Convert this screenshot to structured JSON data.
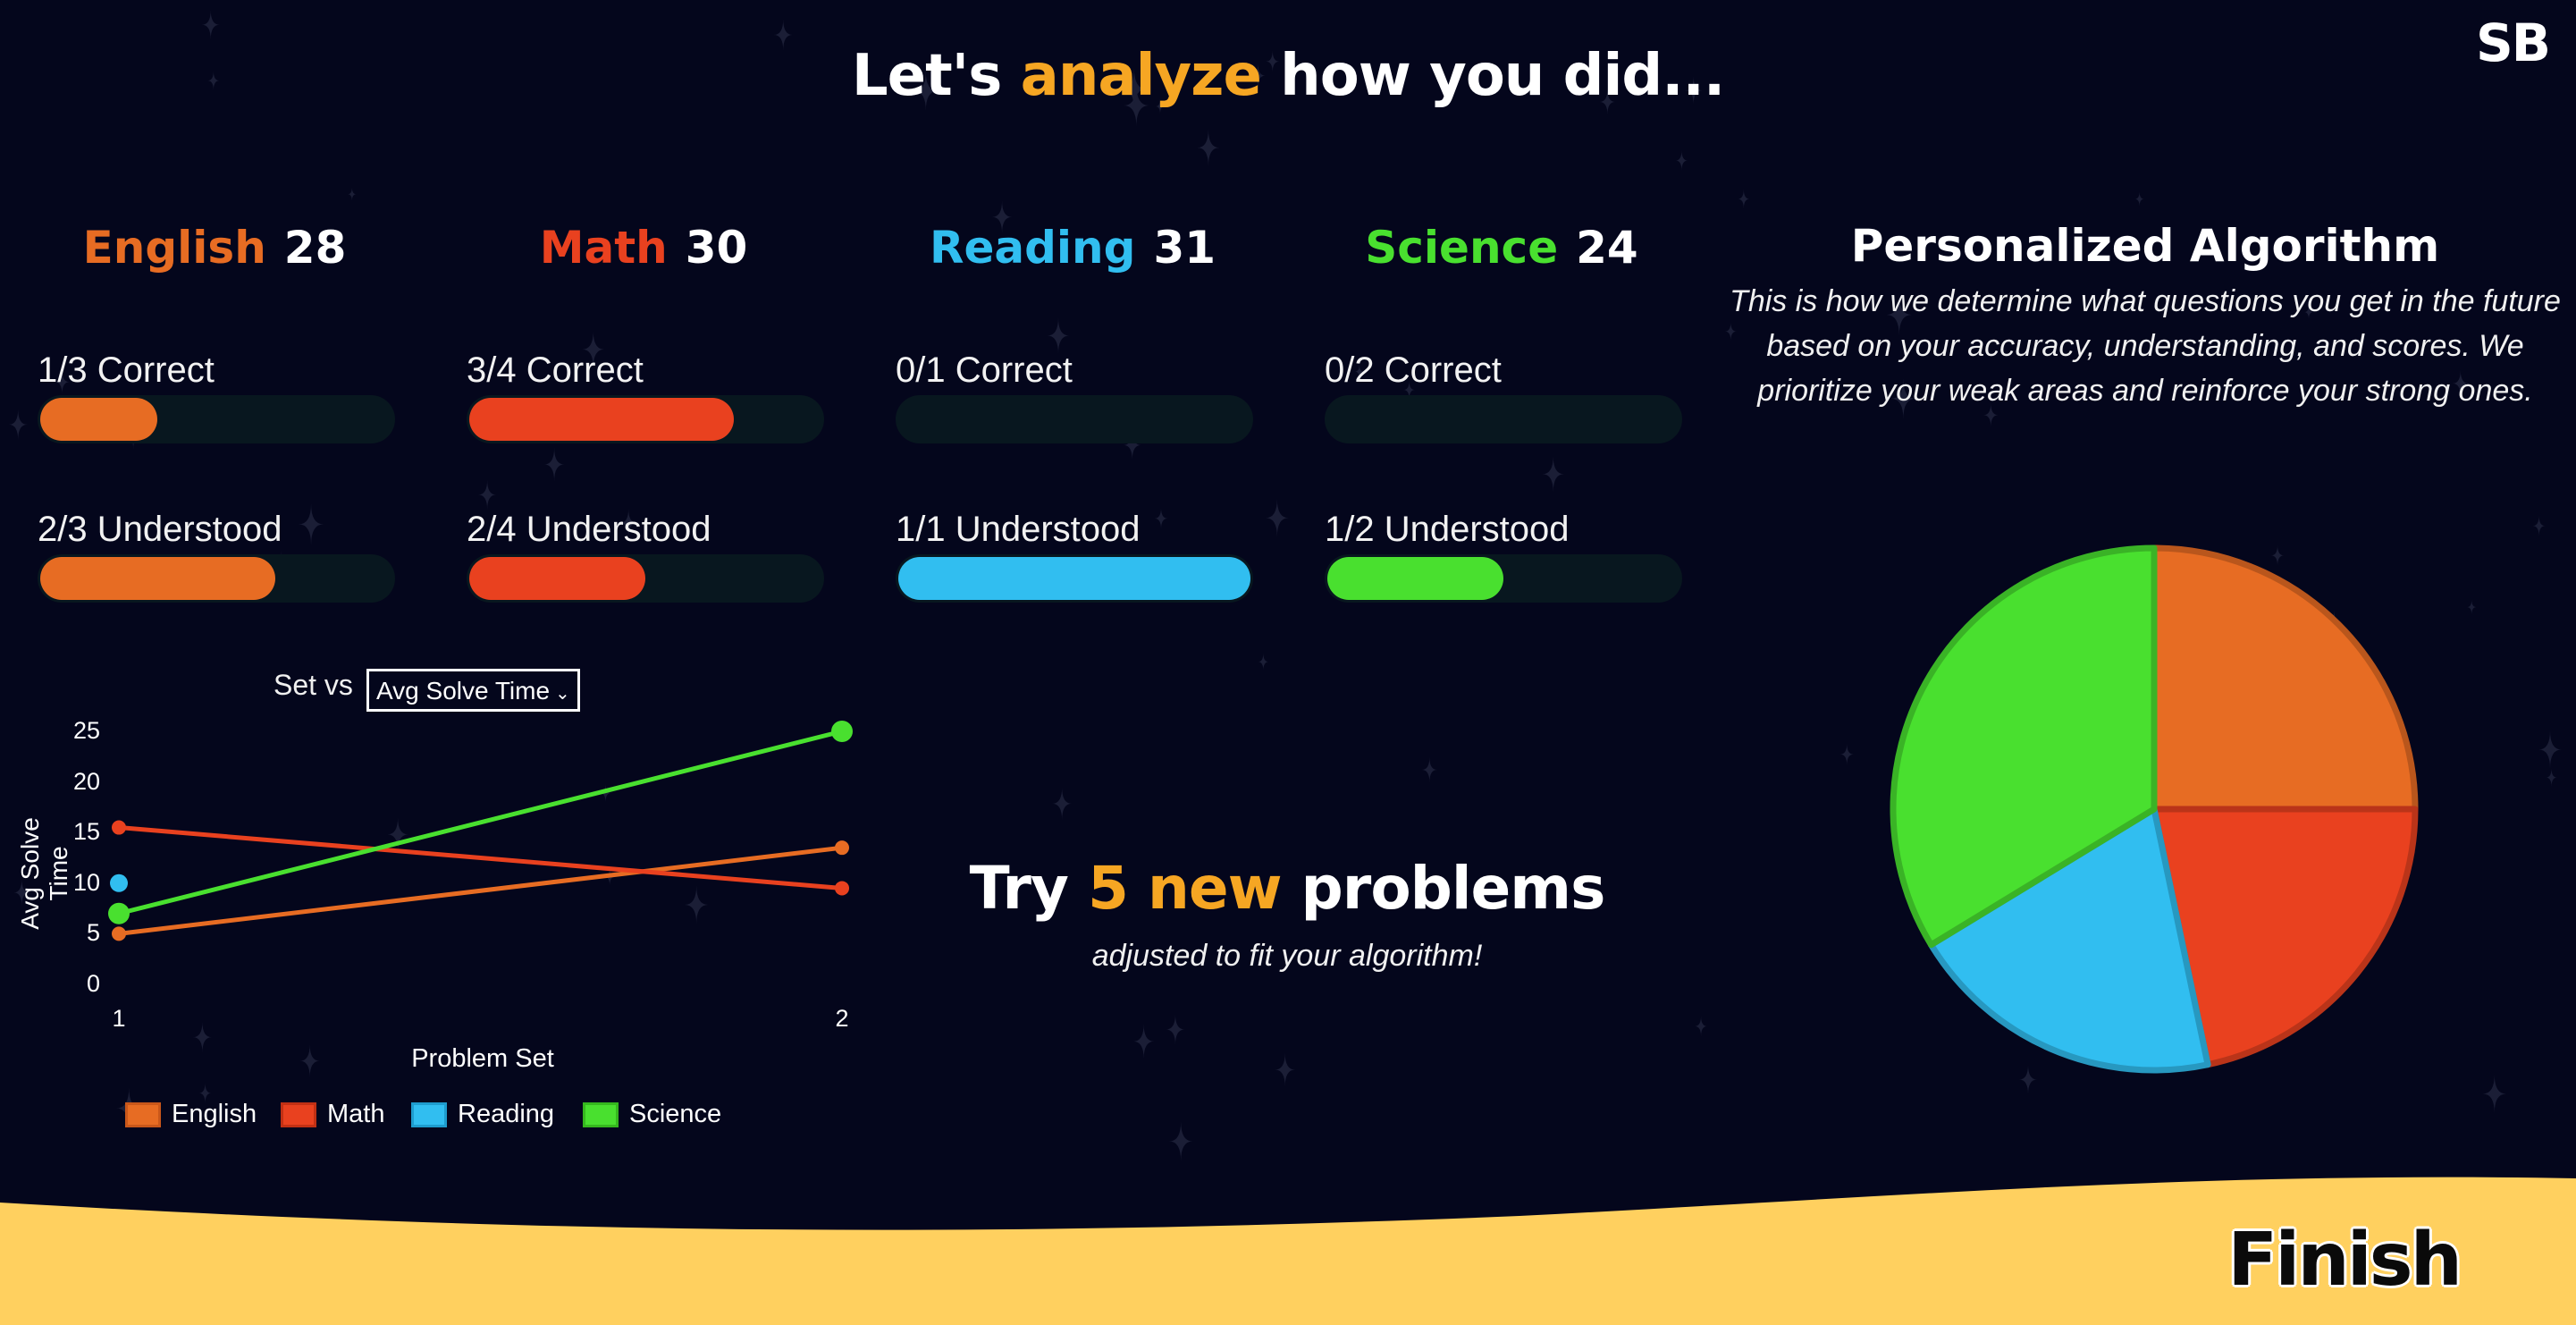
{
  "header": {
    "title_pre": "Let's ",
    "title_accent": "analyze",
    "title_post": " how you did...",
    "accent_color": "#f6a623",
    "avatar_initials": "SB"
  },
  "subjects": [
    {
      "name": "English",
      "score": "28",
      "color": "#e76c23",
      "correct_label": "1/3 Correct",
      "correct_fraction": 0.333,
      "understood_label": "2/3 Understood",
      "understood_fraction": 0.667
    },
    {
      "name": "Math",
      "score": "30",
      "color": "#e9411f",
      "correct_label": "3/4 Correct",
      "correct_fraction": 0.75,
      "understood_label": "2/4 Understood",
      "understood_fraction": 0.5
    },
    {
      "name": "Reading",
      "score": "31",
      "color": "#31bef0",
      "correct_label": "0/1 Correct",
      "correct_fraction": 0,
      "understood_label": "1/1 Understood",
      "understood_fraction": 1
    },
    {
      "name": "Science",
      "score": "24",
      "color": "#49e02f",
      "correct_label": "0/2 Correct",
      "correct_fraction": 0,
      "understood_label": "1/2 Understood",
      "understood_fraction": 0.5
    }
  ],
  "algorithm": {
    "title": "Personalized Algorithm",
    "description": "This is how we determine what questions you get in the future based on your accuracy, understanding, and scores. We prioritize your weak areas and reinforce your strong ones."
  },
  "promo": {
    "pre": "Try ",
    "accent": "5 new",
    "post": " problems",
    "subtitle": "adjusted to fit your algorithm!"
  },
  "chart_controls": {
    "set_label": "Set vs",
    "metric_value": "Avg Solve Time"
  },
  "chart_data": [
    {
      "type": "line",
      "xlabel": "Problem Set",
      "ylabel": "Avg Solve Time",
      "x": [
        1,
        2
      ],
      "x_ticks": [
        "1",
        "2"
      ],
      "y_ticks": [
        "0",
        "5",
        "10",
        "15",
        "20",
        "25"
      ],
      "ylim": [
        0,
        25
      ],
      "legend_position": "bottom",
      "series": [
        {
          "name": "English",
          "color": "#e76c23",
          "values": [
            5,
            13.5
          ]
        },
        {
          "name": "Math",
          "color": "#e9411f",
          "values": [
            15.5,
            9.5
          ]
        },
        {
          "name": "Reading",
          "color": "#31bef0",
          "values": [
            10,
            null
          ]
        },
        {
          "name": "Science",
          "color": "#49e02f",
          "values": [
            7,
            25
          ]
        }
      ]
    },
    {
      "type": "pie",
      "slices": [
        {
          "name": "English",
          "color": "#e76c23",
          "value": 0.25
        },
        {
          "name": "Math",
          "color": "#e9411f",
          "value": 0.217
        },
        {
          "name": "Reading",
          "color": "#31bef0",
          "value": 0.196
        },
        {
          "name": "Science",
          "color": "#49e02f",
          "value": 0.337
        }
      ]
    }
  ],
  "footer": {
    "finish_label": "Finish",
    "wave_color": "#ffd05f"
  }
}
